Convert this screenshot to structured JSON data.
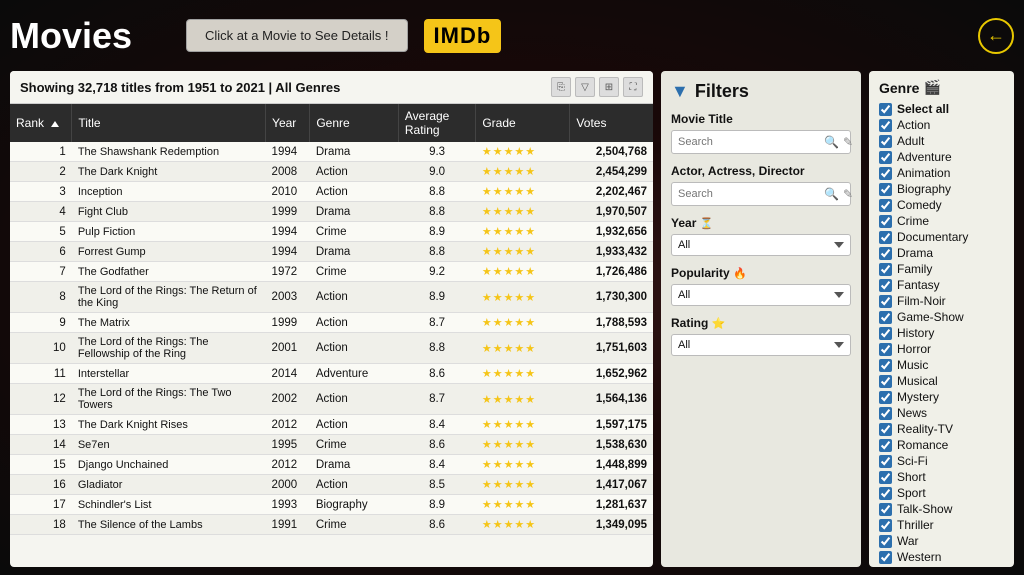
{
  "header": {
    "title": "Movies",
    "hint_button": "Click at a Movie to See Details !",
    "imdb_label": "IMDb",
    "back_icon": "←"
  },
  "table": {
    "showing_text": "Showing 32,718 titles from 1951 to 2021 | All Genres",
    "columns": [
      "Rank",
      "Title",
      "Year",
      "Genre",
      "Average Rating",
      "Grade",
      "Votes"
    ],
    "rows": [
      {
        "rank": 1,
        "title": "The Shawshank Redemption",
        "year": 1994,
        "genre": "Drama",
        "rating": "9.3",
        "stars": "★★★★★",
        "votes": "2,504,768"
      },
      {
        "rank": 2,
        "title": "The Dark Knight",
        "year": 2008,
        "genre": "Action",
        "rating": "9.0",
        "stars": "★★★★★",
        "votes": "2,454,299"
      },
      {
        "rank": 3,
        "title": "Inception",
        "year": 2010,
        "genre": "Action",
        "rating": "8.8",
        "stars": "★★★★★",
        "votes": "2,202,467"
      },
      {
        "rank": 4,
        "title": "Fight Club",
        "year": 1999,
        "genre": "Drama",
        "rating": "8.8",
        "stars": "★★★★★",
        "votes": "1,970,507"
      },
      {
        "rank": 5,
        "title": "Pulp Fiction",
        "year": 1994,
        "genre": "Crime",
        "rating": "8.9",
        "stars": "★★★★★",
        "votes": "1,932,656"
      },
      {
        "rank": 6,
        "title": "Forrest Gump",
        "year": 1994,
        "genre": "Drama",
        "rating": "8.8",
        "stars": "★★★★★",
        "votes": "1,933,432"
      },
      {
        "rank": 7,
        "title": "The Godfather",
        "year": 1972,
        "genre": "Crime",
        "rating": "9.2",
        "stars": "★★★★★",
        "votes": "1,726,486"
      },
      {
        "rank": 8,
        "title": "The Lord of the Rings: The Return of the King",
        "year": 2003,
        "genre": "Action",
        "rating": "8.9",
        "stars": "★★★★★",
        "votes": "1,730,300"
      },
      {
        "rank": 9,
        "title": "The Matrix",
        "year": 1999,
        "genre": "Action",
        "rating": "8.7",
        "stars": "★★★★★",
        "votes": "1,788,593"
      },
      {
        "rank": 10,
        "title": "The Lord of the Rings: The Fellowship of the Ring",
        "year": 2001,
        "genre": "Action",
        "rating": "8.8",
        "stars": "★★★★★",
        "votes": "1,751,603"
      },
      {
        "rank": 11,
        "title": "Interstellar",
        "year": 2014,
        "genre": "Adventure",
        "rating": "8.6",
        "stars": "★★★★★",
        "votes": "1,652,962"
      },
      {
        "rank": 12,
        "title": "The Lord of the Rings: The Two Towers",
        "year": 2002,
        "genre": "Action",
        "rating": "8.7",
        "stars": "★★★★★",
        "votes": "1,564,136"
      },
      {
        "rank": 13,
        "title": "The Dark Knight Rises",
        "year": 2012,
        "genre": "Action",
        "rating": "8.4",
        "stars": "★★★★★",
        "votes": "1,597,175"
      },
      {
        "rank": 14,
        "title": "Se7en",
        "year": 1995,
        "genre": "Crime",
        "rating": "8.6",
        "stars": "★★★★★",
        "votes": "1,538,630"
      },
      {
        "rank": 15,
        "title": "Django Unchained",
        "year": 2012,
        "genre": "Drama",
        "rating": "8.4",
        "stars": "★★★★★",
        "votes": "1,448,899"
      },
      {
        "rank": 16,
        "title": "Gladiator",
        "year": 2000,
        "genre": "Action",
        "rating": "8.5",
        "stars": "★★★★★",
        "votes": "1,417,067"
      },
      {
        "rank": 17,
        "title": "Schindler's List",
        "year": 1993,
        "genre": "Biography",
        "rating": "8.9",
        "stars": "★★★★★",
        "votes": "1,281,637"
      },
      {
        "rank": 18,
        "title": "The Silence of the Lambs",
        "year": 1991,
        "genre": "Crime",
        "rating": "8.6",
        "stars": "★★★★★",
        "votes": "1,349,095"
      }
    ]
  },
  "filters": {
    "title": "Filters",
    "movie_title_label": "Movie Title",
    "movie_title_placeholder": "Search",
    "actor_label": "Actor, Actress, Director",
    "actor_placeholder": "Search",
    "year_label": "Year",
    "year_icon": "⏳",
    "year_default": "All",
    "popularity_label": "Popularity",
    "popularity_icon": "🔥",
    "popularity_default": "All",
    "rating_label": "Rating",
    "rating_icon": "⭐",
    "rating_default": "All"
  },
  "genres": {
    "title": "Genre",
    "icon": "🎬",
    "items": [
      {
        "label": "Select all",
        "checked": true,
        "bold": true
      },
      {
        "label": "Action",
        "checked": true
      },
      {
        "label": "Adult",
        "checked": true
      },
      {
        "label": "Adventure",
        "checked": true
      },
      {
        "label": "Animation",
        "checked": true
      },
      {
        "label": "Biography",
        "checked": true
      },
      {
        "label": "Comedy",
        "checked": true
      },
      {
        "label": "Crime",
        "checked": true
      },
      {
        "label": "Documentary",
        "checked": true
      },
      {
        "label": "Drama",
        "checked": true
      },
      {
        "label": "Family",
        "checked": true
      },
      {
        "label": "Fantasy",
        "checked": true
      },
      {
        "label": "Film-Noir",
        "checked": true
      },
      {
        "label": "Game-Show",
        "checked": true
      },
      {
        "label": "History",
        "checked": true
      },
      {
        "label": "Horror",
        "checked": true
      },
      {
        "label": "Music",
        "checked": true
      },
      {
        "label": "Musical",
        "checked": true
      },
      {
        "label": "Mystery",
        "checked": true
      },
      {
        "label": "News",
        "checked": true
      },
      {
        "label": "Reality-TV",
        "checked": true
      },
      {
        "label": "Romance",
        "checked": true
      },
      {
        "label": "Sci-Fi",
        "checked": true
      },
      {
        "label": "Short",
        "checked": true
      },
      {
        "label": "Sport",
        "checked": true
      },
      {
        "label": "Talk-Show",
        "checked": true
      },
      {
        "label": "Thriller",
        "checked": true
      },
      {
        "label": "War",
        "checked": true
      },
      {
        "label": "Western",
        "checked": true
      }
    ]
  }
}
